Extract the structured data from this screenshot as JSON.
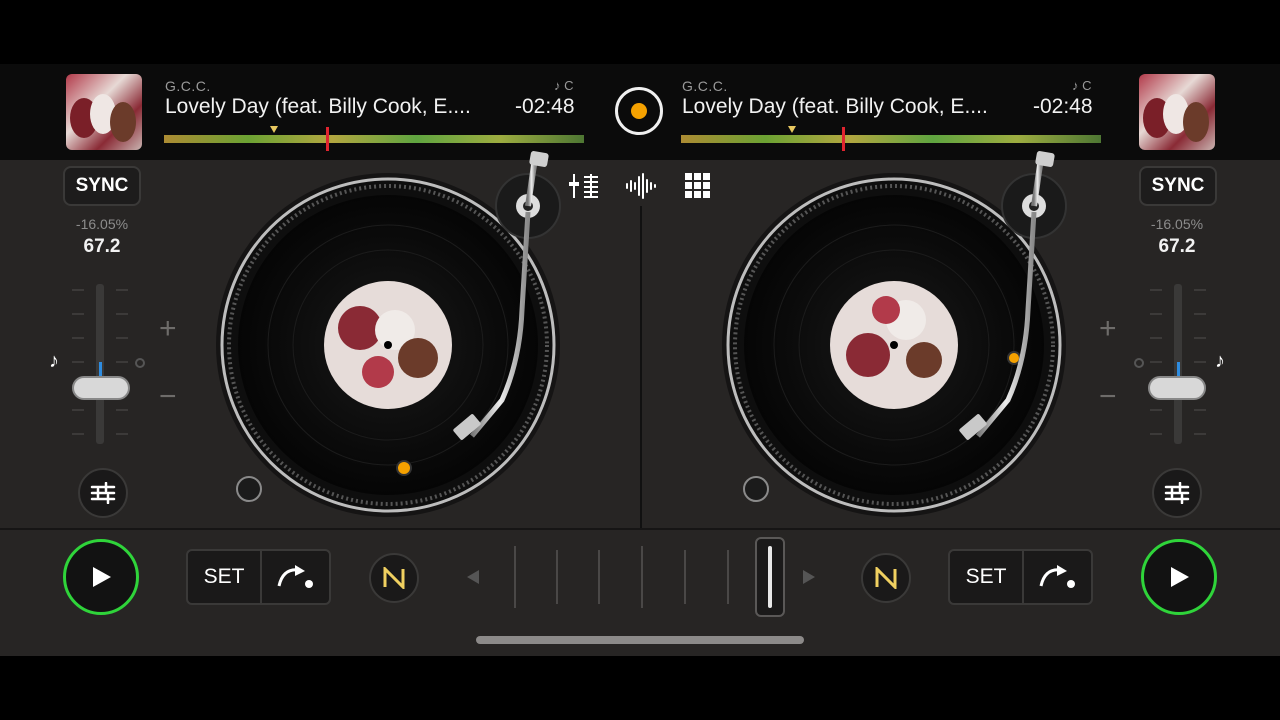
{
  "decks": {
    "left": {
      "artist": "G.C.C.",
      "title": "Lovely Day (feat. Billy Cook, E....",
      "time": "-02:48",
      "key_info": "♪ C",
      "sync_label": "SYNC",
      "pitch_percent": "-16.05%",
      "bpm": "67.2",
      "set_label": "SET"
    },
    "right": {
      "artist": "G.C.C.",
      "title": "Lovely Day (feat. Billy Cook, E....",
      "time": "-02:48",
      "key_info": "♪ C",
      "sync_label": "SYNC",
      "pitch_percent": "-16.05%",
      "bpm": "67.2",
      "set_label": "SET"
    }
  },
  "center": {
    "plus": "+",
    "minus": "−"
  },
  "colors": {
    "accent_orange": "#f5a100",
    "play_ring": "#2fd43a",
    "playhead": "#e0242f"
  },
  "icons": [
    "record-button-icon",
    "mixer-icon",
    "waveform-icon",
    "pads-grid-icon",
    "music-note-icon",
    "eq-sliders-icon",
    "play-icon",
    "loop-arrow-icon",
    "neural-mix-icon",
    "crossfader-left-arrow-icon",
    "crossfader-right-arrow-icon"
  ]
}
